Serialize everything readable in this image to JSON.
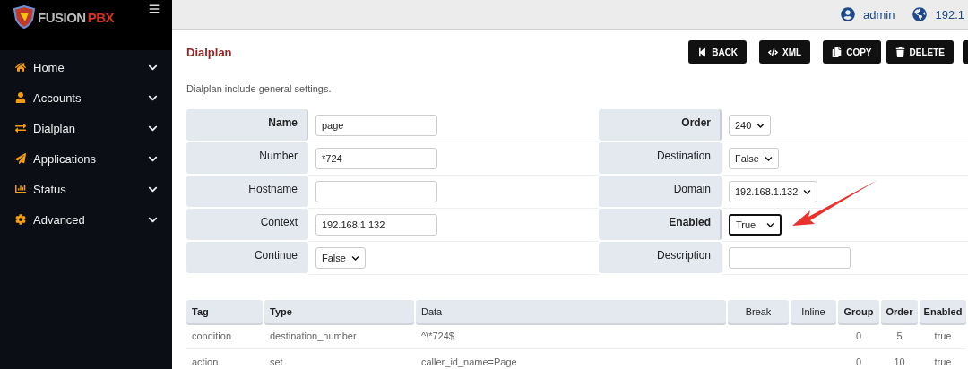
{
  "sidebar": {
    "logo": {
      "word": "FUSION",
      "suffix": "PBX"
    },
    "items": [
      {
        "label": "Home"
      },
      {
        "label": "Accounts"
      },
      {
        "label": "Dialplan"
      },
      {
        "label": "Applications"
      },
      {
        "label": "Status"
      },
      {
        "label": "Advanced"
      }
    ]
  },
  "top_bar": {
    "user": "admin",
    "host": "192.1"
  },
  "page": {
    "title": "Dialplan",
    "description": "Dialplan include general settings.",
    "buttons": [
      {
        "label": "BACK"
      },
      {
        "label": "XML"
      },
      {
        "label": "COPY"
      },
      {
        "label": "DELETE"
      }
    ]
  },
  "form": {
    "fields": [
      {
        "label": "Name",
        "kind": "input",
        "value": "page",
        "required": true
      },
      {
        "label": "Order",
        "kind": "select",
        "value": "240",
        "required": true
      },
      {
        "label": "Number",
        "kind": "input",
        "value": "*724",
        "required": false
      },
      {
        "label": "Destination",
        "kind": "select",
        "value": "False",
        "required": false
      },
      {
        "label": "Hostname",
        "kind": "input",
        "required": false
      },
      {
        "label": "Domain",
        "kind": "select",
        "value": "192.168.1.132",
        "required": false
      },
      {
        "label": "Context",
        "kind": "input",
        "value": "192.168.1.132",
        "required": false
      },
      {
        "label": "Enabled",
        "kind": "select",
        "value": "True",
        "required": true,
        "focused": true
      },
      {
        "label": "Continue",
        "kind": "select",
        "value": "False",
        "required": false
      },
      {
        "label": "Description",
        "kind": "input",
        "required": false
      }
    ]
  },
  "table": {
    "columns": [
      "Tag",
      "Type",
      "Data",
      "Break",
      "Inline",
      "Group",
      "Order",
      "Enabled"
    ],
    "rows": [
      [
        "condition",
        "destination_number",
        "^\\*724$",
        null,
        null,
        "0",
        "5",
        "true"
      ],
      [
        "action",
        "set",
        "caller_id_name=Page",
        null,
        null,
        "0",
        "10",
        "true"
      ]
    ]
  }
}
